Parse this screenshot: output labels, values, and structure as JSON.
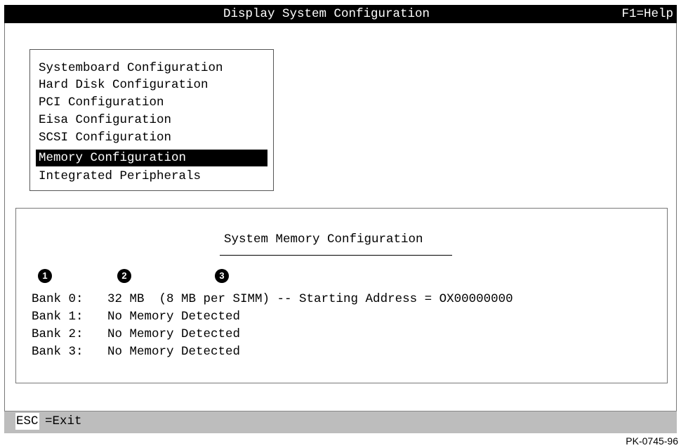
{
  "header": {
    "title": "Display System Configuration",
    "help": "F1=Help"
  },
  "menu": {
    "items": [
      {
        "label": "Systemboard Configuration",
        "selected": false
      },
      {
        "label": "Hard Disk Configuration",
        "selected": false
      },
      {
        "label": "PCI Configuration",
        "selected": false
      },
      {
        "label": "Eisa Configuration",
        "selected": false
      },
      {
        "label": "SCSI Configuration",
        "selected": false
      },
      {
        "label": "Memory Configuration",
        "selected": true
      },
      {
        "label": "Integrated Peripherals",
        "selected": false
      }
    ]
  },
  "memory_panel": {
    "title": "System Memory Configuration",
    "callouts": [
      "1",
      "2",
      "3"
    ],
    "banks": [
      {
        "label": "Bank 0:",
        "value": "32 MB  (8 MB per SIMM) -- Starting Address = OX00000000"
      },
      {
        "label": "Bank 1:",
        "value": "No Memory Detected"
      },
      {
        "label": "Bank 2:",
        "value": "No Memory Detected"
      },
      {
        "label": "Bank 3:",
        "value": "No Memory Detected"
      }
    ]
  },
  "status_bar": {
    "key": "ESC",
    "action": "=Exit"
  },
  "figure_id": "PK-0745-96",
  "colors": {
    "title_bar_bg": "#000000",
    "title_bar_fg": "#ffffff",
    "selection_bg": "#000000",
    "status_bar_bg": "#bdbdbd"
  }
}
